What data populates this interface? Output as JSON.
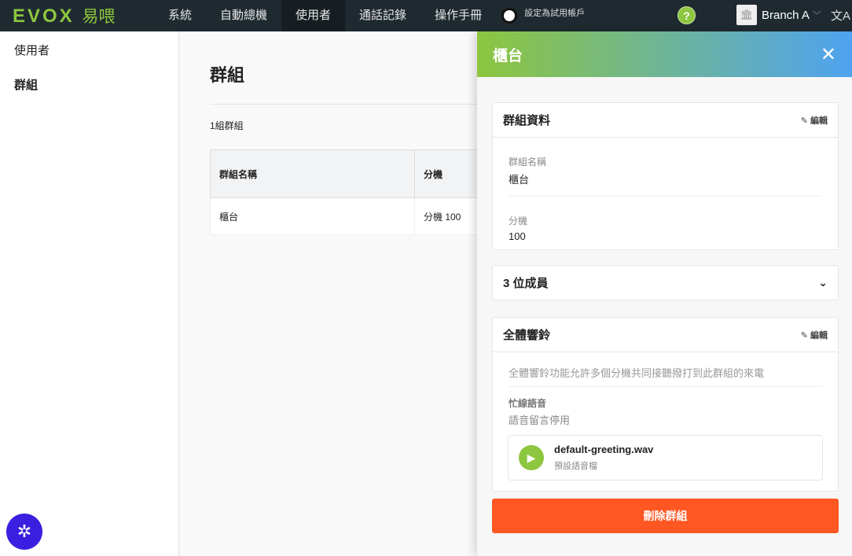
{
  "nav": {
    "logo": "EVOX",
    "logo_cn": "易喂",
    "items": [
      "系統",
      "自動總機",
      "使用者",
      "通話記錄",
      "操作手冊"
    ],
    "trial_label": "設定為試用帳戶",
    "help": "?",
    "branch": "Branch A",
    "lang_icon": "文A"
  },
  "sidebar": {
    "items": [
      "使用者",
      "群組"
    ]
  },
  "main": {
    "title": "群組",
    "count": "1組群組",
    "table": {
      "headers": [
        "群組名稱",
        "分機"
      ],
      "rows": [
        [
          "櫃台",
          "分機 100"
        ]
      ]
    }
  },
  "drawer": {
    "title": "櫃台",
    "info": {
      "title": "群組資料",
      "edit": "編輯",
      "fields": [
        {
          "label": "群組名稱",
          "value": "櫃台"
        },
        {
          "label": "分機",
          "value": "100"
        }
      ]
    },
    "members": {
      "title": "3 位成員"
    },
    "ring": {
      "title": "全體響鈴",
      "edit": "編輯",
      "desc": "全體響鈴功能允許多個分機共同接聽撥打到此群組的來電",
      "busy_label": "忙線語音",
      "busy_value": "語音留言停用",
      "file": "default-greeting.wav",
      "file_sub": "預設語音檔"
    },
    "delete": "刪除群組"
  },
  "colors": {
    "accent": "#8dc63f",
    "danger": "#ff5722",
    "nav": "#1f2a30"
  }
}
